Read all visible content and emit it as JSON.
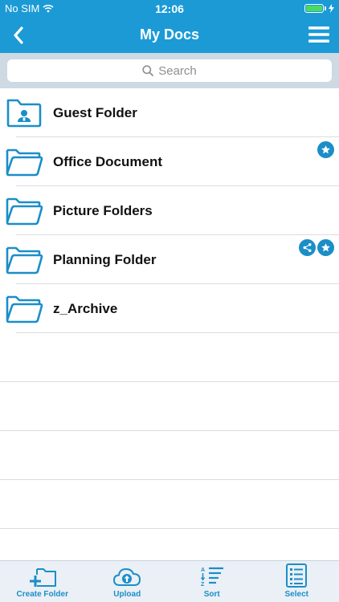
{
  "status_bar": {
    "carrier": "No SIM",
    "time": "12:06"
  },
  "nav": {
    "title": "My Docs",
    "back_icon": "chevron-left-icon",
    "menu_icon": "hamburger-menu-icon"
  },
  "search": {
    "placeholder": "Search"
  },
  "folders": [
    {
      "name": "Guest Folder",
      "icon": "guest-folder-icon",
      "badges": []
    },
    {
      "name": "Office Document",
      "icon": "folder-icon",
      "badges": [
        "star"
      ]
    },
    {
      "name": "Picture Folders",
      "icon": "folder-icon",
      "badges": []
    },
    {
      "name": "Planning Folder",
      "icon": "folder-icon",
      "badges": [
        "share",
        "star"
      ]
    },
    {
      "name": "z_Archive",
      "icon": "folder-icon",
      "badges": []
    }
  ],
  "toolbar": {
    "create_folder": "Create Folder",
    "upload": "Upload",
    "sort": "Sort",
    "select": "Select"
  },
  "colors": {
    "primary": "#1b9ad6",
    "icon_blue": "#1b8ec7",
    "search_bar_bg": "#cdd9e3",
    "toolbar_bg": "#eaf0f6"
  }
}
